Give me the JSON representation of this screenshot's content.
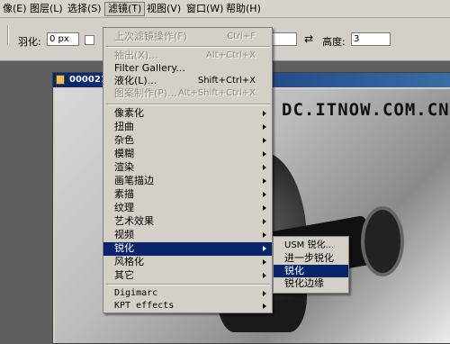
{
  "menubar": {
    "items": [
      "像(E)",
      "图层(L)",
      "选择(S)",
      "滤镜(T)",
      "视图(V)",
      "窗口(W)",
      "帮助(H)"
    ]
  },
  "options": {
    "feather_label": "羽化:",
    "feather_value": "0 px",
    "height_label": "高度:",
    "height_value": "3",
    "swap_icon": "swap-arrows-icon"
  },
  "document": {
    "title": "000021...",
    "watermark": "DC.ITNOW.COM.CN"
  },
  "filter_menu": {
    "items": [
      {
        "label": "上次滤镜操作(F)",
        "shortcut": "Ctrl+F",
        "disabled": true
      },
      {
        "label": "抽出(X)...",
        "shortcut": "Alt+Ctrl+X",
        "disabled": true
      },
      {
        "label": "Filter Gallery...",
        "shortcut": ""
      },
      {
        "label": "液化(L)...",
        "shortcut": "Shift+Ctrl+X"
      },
      {
        "label": "图案制作(P)...",
        "shortcut": "Alt+Shift+Ctrl+X",
        "disabled": true
      },
      {
        "label": "像素化",
        "submenu": true
      },
      {
        "label": "扭曲",
        "submenu": true
      },
      {
        "label": "杂色",
        "submenu": true
      },
      {
        "label": "模糊",
        "submenu": true
      },
      {
        "label": "渲染",
        "submenu": true
      },
      {
        "label": "画笔描边",
        "submenu": true
      },
      {
        "label": "素描",
        "submenu": true
      },
      {
        "label": "纹理",
        "submenu": true
      },
      {
        "label": "艺术效果",
        "submenu": true
      },
      {
        "label": "视频",
        "submenu": true
      },
      {
        "label": "锐化",
        "submenu": true,
        "highlighted": true
      },
      {
        "label": "风格化",
        "submenu": true
      },
      {
        "label": "其它",
        "submenu": true
      },
      {
        "label": "Digimarc",
        "submenu": true
      },
      {
        "label": "KPT effects",
        "submenu": true
      }
    ]
  },
  "sharpen_submenu": {
    "items": [
      {
        "label": "USM 锐化..."
      },
      {
        "label": "进一步锐化"
      },
      {
        "label": "锐化",
        "highlighted": true
      },
      {
        "label": "锐化边缘"
      }
    ]
  }
}
